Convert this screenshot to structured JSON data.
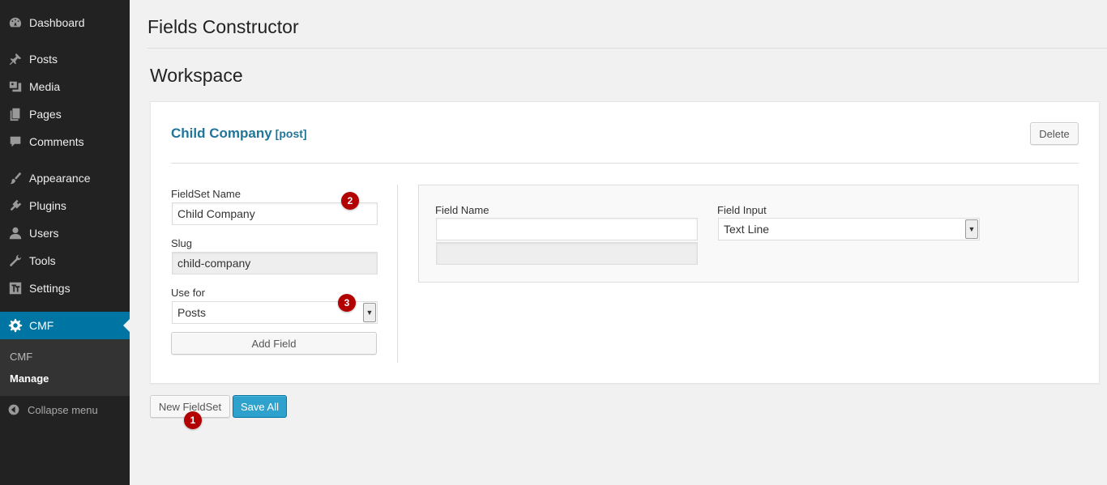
{
  "sidebar": {
    "items": [
      {
        "label": "Dashboard",
        "icon": "dashboard-icon"
      },
      {
        "label": "Posts",
        "icon": "pushpin-icon"
      },
      {
        "label": "Media",
        "icon": "media-icon"
      },
      {
        "label": "Pages",
        "icon": "pages-icon"
      },
      {
        "label": "Comments",
        "icon": "comment-icon"
      },
      {
        "label": "Appearance",
        "icon": "paintbrush-icon"
      },
      {
        "label": "Plugins",
        "icon": "plugin-icon"
      },
      {
        "label": "Users",
        "icon": "user-icon"
      },
      {
        "label": "Tools",
        "icon": "wrench-icon"
      },
      {
        "label": "Settings",
        "icon": "settings-icon"
      },
      {
        "label": "CMF",
        "icon": "gear-icon"
      }
    ],
    "submenu": [
      "CMF",
      "Manage"
    ],
    "collapse_label": "Collapse menu"
  },
  "page": {
    "title": "Fields Constructor",
    "workspace_title": "Workspace"
  },
  "fieldset": {
    "title": "Child Company",
    "post_type_tag": "[post]",
    "delete_label": "Delete",
    "name_label": "FieldSet Name",
    "name_value": "Child Company",
    "slug_label": "Slug",
    "slug_value": "child-company",
    "use_for_label": "Use for",
    "use_for_value": "Posts",
    "add_field_label": "Add Field"
  },
  "field": {
    "name_label": "Field Name",
    "name_value": "",
    "input_label": "Field Input",
    "input_value": "Text Line"
  },
  "footer": {
    "new_fieldset_label": "New FieldSet",
    "save_all_label": "Save All"
  },
  "badges": [
    "1",
    "2",
    "3"
  ],
  "colors": {
    "sidebar_bg": "#222222",
    "active_menu": "#0074a2",
    "link_blue": "#21759b",
    "primary_button": "#2ea2cc",
    "badge_red": "#b30000"
  }
}
